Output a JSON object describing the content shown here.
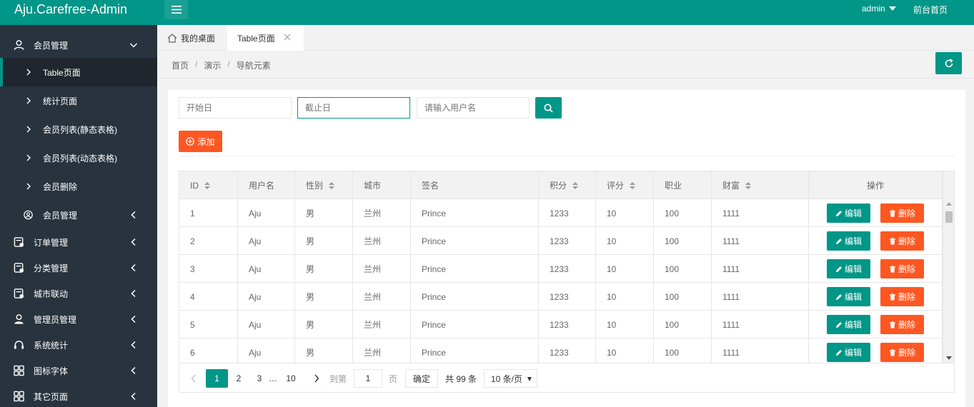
{
  "header": {
    "logo": "Aju.Carefree-Admin",
    "user": "admin",
    "front_home": "前台首页"
  },
  "sidebar": {
    "groups": [
      {
        "label": "会员管理",
        "icon": "user-icon",
        "expanded": true
      },
      {
        "label": "会员管理",
        "icon": "user-circle-icon",
        "expanded": false
      },
      {
        "label": "订单管理",
        "icon": "order-icon",
        "expanded": false
      },
      {
        "label": "分类管理",
        "icon": "category-icon",
        "expanded": false
      },
      {
        "label": "城市联动",
        "icon": "city-icon",
        "expanded": false
      },
      {
        "label": "管理员管理",
        "icon": "admin-user-icon",
        "expanded": false
      },
      {
        "label": "系统统计",
        "icon": "headset-icon",
        "expanded": false
      },
      {
        "label": "图标字体",
        "icon": "grid-icon",
        "expanded": false
      },
      {
        "label": "其它页面",
        "icon": "grid-icon",
        "expanded": false
      }
    ],
    "sub_items": [
      {
        "label": "Table页面",
        "active": true
      },
      {
        "label": "统计页面",
        "active": false
      },
      {
        "label": "会员列表(静态表格)",
        "active": false
      },
      {
        "label": "会员列表(动态表格)",
        "active": false
      },
      {
        "label": "会员删除",
        "active": false
      }
    ]
  },
  "tabs": [
    {
      "label": "我的桌面",
      "icon": "home-icon"
    },
    {
      "label": "Table页面",
      "closable": true
    }
  ],
  "breadcrumb": [
    "首页",
    "演示",
    "导航元素"
  ],
  "filters": {
    "start_placeholder": "开始日",
    "end_placeholder": "截止日",
    "user_placeholder": "请输入用户名"
  },
  "add_label": "添加",
  "table": {
    "columns": [
      "ID",
      "用户名",
      "性别",
      "城市",
      "签名",
      "积分",
      "评分",
      "职业",
      "财富",
      "操作"
    ],
    "sortable": [
      true,
      false,
      true,
      false,
      false,
      true,
      true,
      false,
      true,
      false
    ],
    "rows": [
      [
        "1",
        "Aju",
        "男",
        "兰州",
        "Prince",
        "1233",
        "10",
        "100",
        "1111"
      ],
      [
        "2",
        "Aju",
        "男",
        "兰州",
        "Prince",
        "1233",
        "10",
        "100",
        "1111"
      ],
      [
        "3",
        "Aju",
        "男",
        "兰州",
        "Prince",
        "1233",
        "10",
        "100",
        "1111"
      ],
      [
        "4",
        "Aju",
        "男",
        "兰州",
        "Prince",
        "1233",
        "10",
        "100",
        "1111"
      ],
      [
        "5",
        "Aju",
        "男",
        "兰州",
        "Prince",
        "1233",
        "10",
        "100",
        "1111"
      ],
      [
        "6",
        "Aju",
        "男",
        "兰州",
        "Prince",
        "1233",
        "10",
        "100",
        "1111"
      ]
    ],
    "edit_label": "编辑",
    "delete_label": "删除"
  },
  "pager": {
    "pages": [
      "1",
      "2",
      "3"
    ],
    "ellipsis": "…",
    "last_page": "10",
    "goto_label": "到第",
    "goto_value": "1",
    "page_suffix": "页",
    "confirm_label": "确定",
    "total_label": "共 99 条",
    "page_size": "10 条/页"
  },
  "colors": {
    "primary": "#009688",
    "danger": "#ff5722",
    "sidebar_bg": "#28333e"
  }
}
